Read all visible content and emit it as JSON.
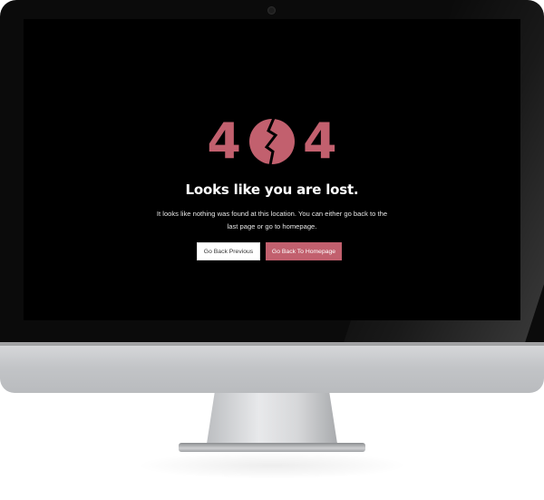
{
  "error_page": {
    "code_first": "4",
    "code_last": "4",
    "code_middle_icon": "broken-circle-icon",
    "headline": "Looks like you are lost.",
    "message": "It looks like nothing was found at this location. You can either go back to the last page or go to homepage.",
    "buttons": {
      "back": "Go Back Previous",
      "home": "Go Back To Homepage"
    }
  },
  "colors": {
    "accent": "#c2606e",
    "screen_background": "#000000",
    "headline_text": "#ffffff"
  }
}
